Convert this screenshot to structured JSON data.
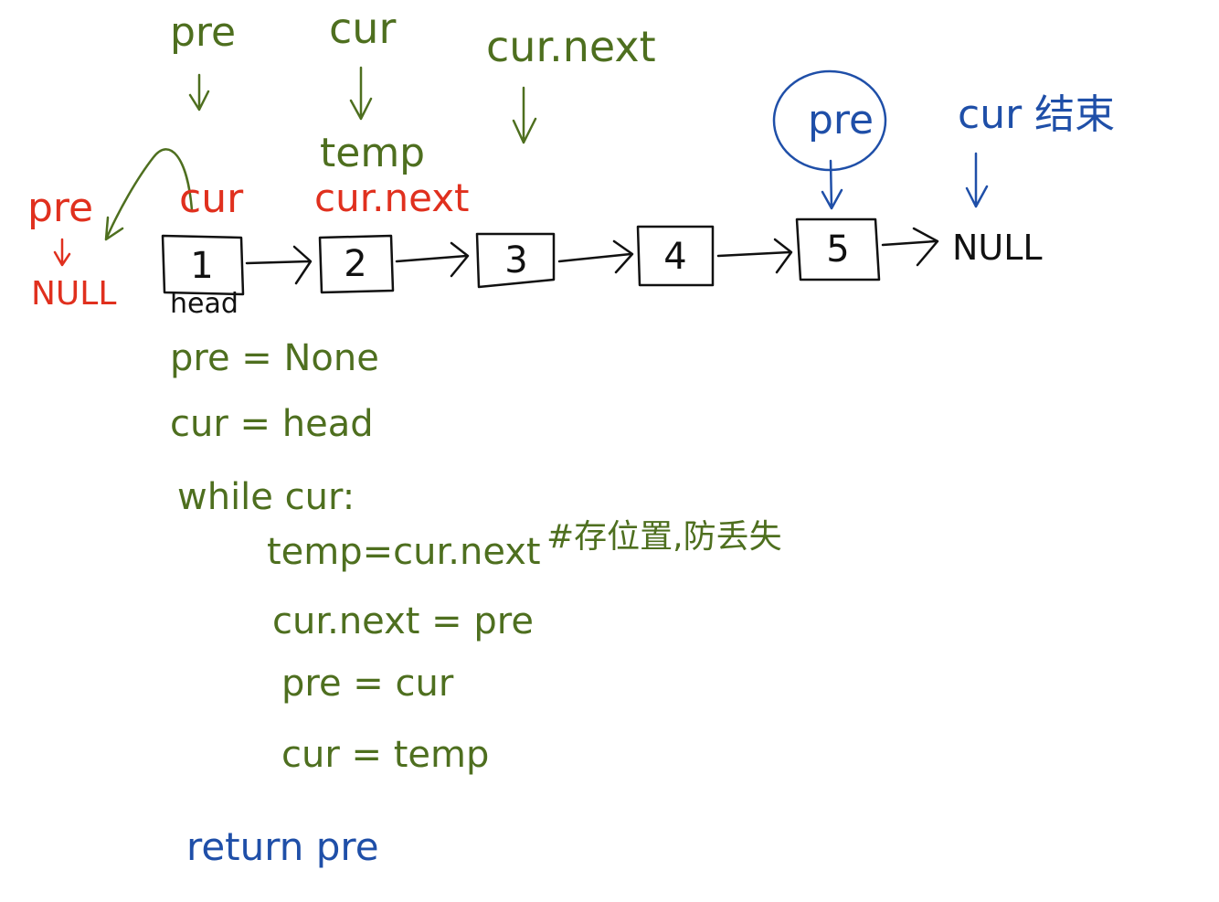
{
  "colors": {
    "green": "#4e6f1f",
    "red": "#e0301e",
    "blue": "#1f4fa8",
    "black": "#111111"
  },
  "top_labels": {
    "pre": "pre",
    "cur": "cur",
    "cur_next": "cur.next",
    "temp": "temp"
  },
  "red_labels": {
    "pre": "pre",
    "null": "NULL",
    "cur": "cur",
    "cur_next": "cur.next"
  },
  "end_labels": {
    "pre": "pre",
    "cur_end": "cur 结束",
    "null": "NULL"
  },
  "nodes": [
    "1",
    "2",
    "3",
    "4",
    "5"
  ],
  "head_label": "head",
  "code": {
    "line1": "pre = None",
    "line2": "cur = head",
    "line3": "while cur:",
    "line4": "temp=cur.next",
    "comment": "#存位置,防丢失",
    "line5": "cur.next = pre",
    "line6": "pre = cur",
    "line7": "cur = temp",
    "return": "return pre"
  }
}
